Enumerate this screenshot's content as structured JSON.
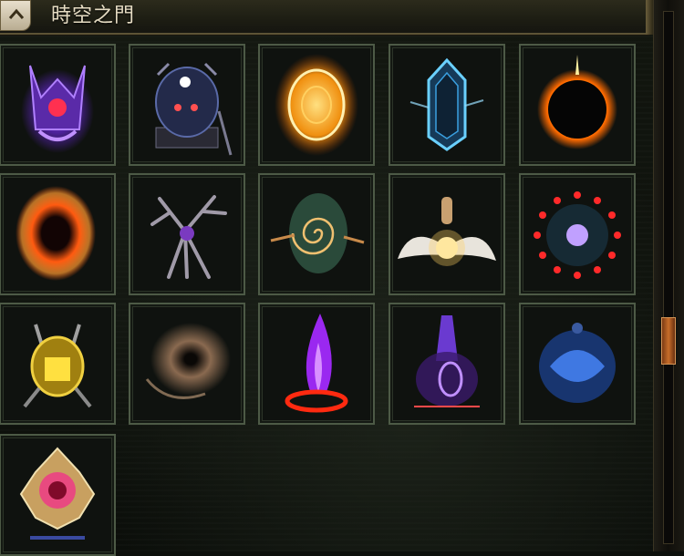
{
  "header": {
    "title": "時空之門",
    "collapse_icon": "chevron-up-icon"
  },
  "portals": [
    {
      "name": "void-crown-portal",
      "icon": "purple-crown-portal-icon",
      "color": "#8a4cff"
    },
    {
      "name": "dark-idol-portal",
      "icon": "dark-shrine-portal-icon",
      "color": "#6a7cff"
    },
    {
      "name": "golden-mirror-portal",
      "icon": "golden-oval-portal-icon",
      "color": "#f0a020"
    },
    {
      "name": "ice-mirror-portal",
      "icon": "ice-crystal-portal-icon",
      "color": "#5ab8ff"
    },
    {
      "name": "eclipse-portal",
      "icon": "black-sun-portal-icon",
      "color": "#ff9a10"
    },
    {
      "name": "fire-ring-portal",
      "icon": "fire-ring-portal-icon",
      "color": "#ff5a10"
    },
    {
      "name": "dead-tree-portal",
      "icon": "twisted-tree-portal-icon",
      "color": "#9a8aa8"
    },
    {
      "name": "feather-swirl-portal",
      "icon": "feather-vortex-portal-icon",
      "color": "#c88a4a"
    },
    {
      "name": "angel-wings-portal",
      "icon": "winged-portal-icon",
      "color": "#fff3c0"
    },
    {
      "name": "blood-orbs-portal",
      "icon": "red-orb-ring-portal-icon",
      "color": "#ff2a2a"
    },
    {
      "name": "golden-relic-portal",
      "icon": "golden-skull-portal-icon",
      "color": "#e8c020"
    },
    {
      "name": "sand-vortex-portal",
      "icon": "dust-vortex-portal-icon",
      "color": "#b88a64"
    },
    {
      "name": "purple-flame-portal",
      "icon": "purple-flame-portal-icon",
      "color": "#b030ff"
    },
    {
      "name": "violet-storm-portal",
      "icon": "violet-spire-portal-icon",
      "color": "#8a3aff"
    },
    {
      "name": "blue-spirit-portal",
      "icon": "blue-ghost-portal-icon",
      "color": "#4a8aff"
    },
    {
      "name": "lotus-portal",
      "icon": "crystal-lotus-portal-icon",
      "color": "#e84a80"
    }
  ],
  "scrollbar": {
    "position": 0.63
  }
}
